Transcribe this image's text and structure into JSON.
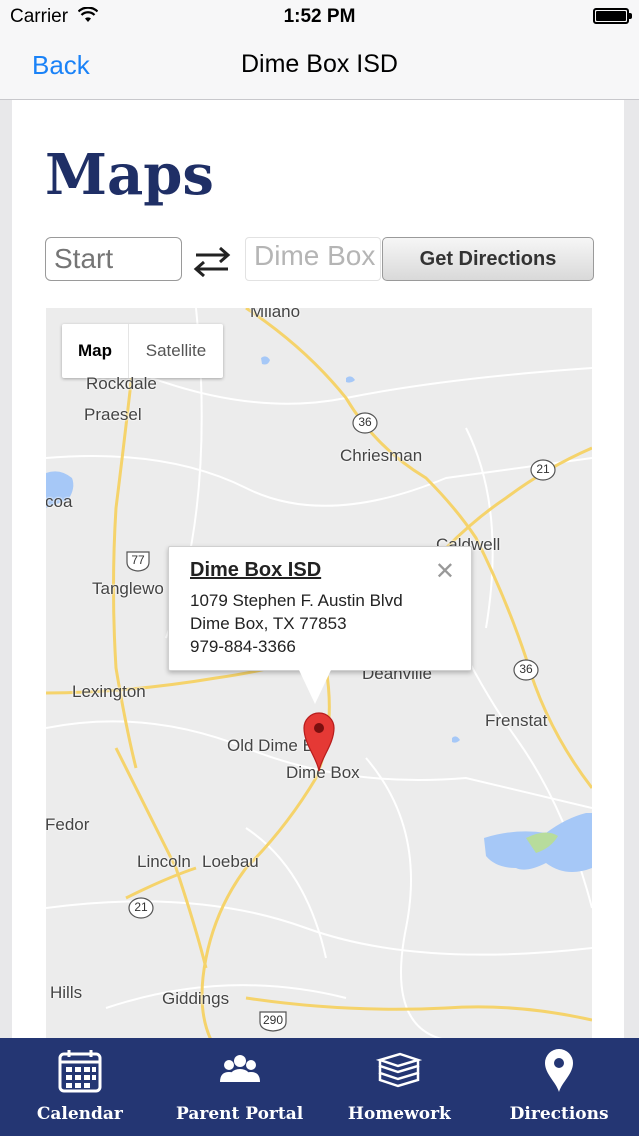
{
  "status_bar": {
    "carrier": "Carrier",
    "time": "1:52 PM"
  },
  "nav": {
    "back_label": "Back",
    "title": "Dime Box ISD"
  },
  "page": {
    "heading": "Maps"
  },
  "directions_form": {
    "start_placeholder": "Start",
    "destination_value": "Dime Box ISD",
    "get_directions_label": "Get Directions"
  },
  "map": {
    "type_options": [
      "Map",
      "Satellite"
    ],
    "selected_type": "Map",
    "places": [
      "Milano",
      "Rockdale",
      "Praesel",
      "Chriesman",
      "Caldwell",
      "Tanglewo",
      "Lexington",
      "Old Dime B",
      "Dime Box",
      "Deanville",
      "Frenstat",
      "Fedor",
      "Lincoln",
      "Loebau",
      "Hills",
      "Giddings",
      "coa"
    ],
    "highway_shields": [
      "36",
      "21",
      "77",
      "36",
      "21",
      "290"
    ],
    "info_window": {
      "title": "Dime Box ISD",
      "address_line1": "1079 Stephen F. Austin Blvd",
      "address_line2": "Dime Box, TX  77853",
      "phone": "979-884-3366"
    },
    "marker_color": "#e53935"
  },
  "tabs": [
    {
      "label": "Calendar",
      "icon": "calendar-icon"
    },
    {
      "label": "Parent Portal",
      "icon": "people-icon"
    },
    {
      "label": "Homework",
      "icon": "books-icon"
    },
    {
      "label": "Directions",
      "icon": "location-pin-icon"
    }
  ],
  "colors": {
    "tab_bar": "#243673",
    "heading": "#1f2f66",
    "link": "#1a82f7"
  }
}
